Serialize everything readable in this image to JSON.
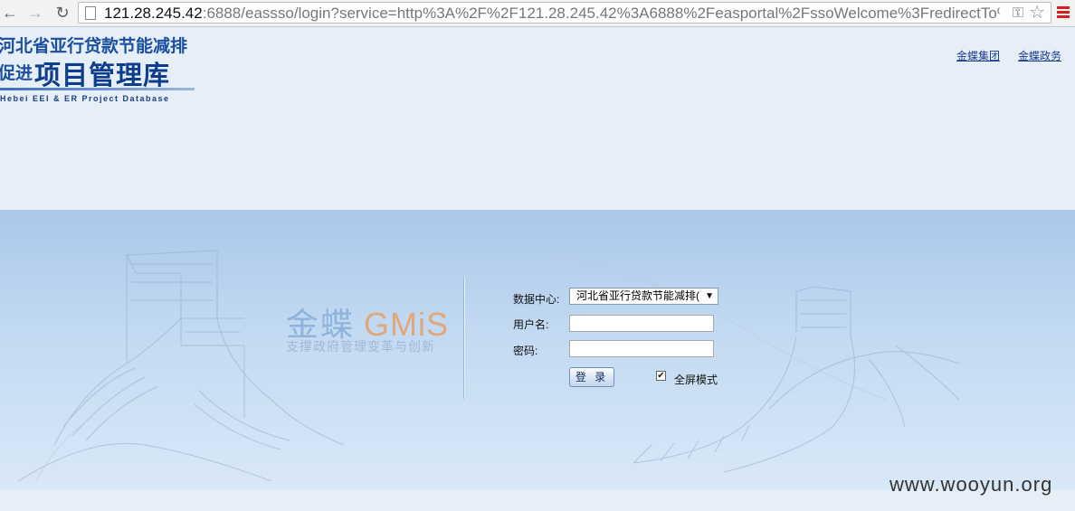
{
  "browser": {
    "url_host": "121.28.245.42",
    "url_rest": ":6888/eassso/login?service=http%3A%2F%2F121.28.245.42%3A6888%2Feasportal%2FssoWelcome%3FredirectTo%3D"
  },
  "header": {
    "logo_line1": "河北省亚行贷款节能减排",
    "logo_line2_prefix": "促进",
    "logo_line2_main": "项目管理库",
    "logo_en": "Hebei EEI & ER Project Database",
    "links": [
      "金蝶集团",
      "金蝶政务"
    ]
  },
  "brand": {
    "cn": "金蝶",
    "en": "GMiS",
    "slogan": "支撑政府管理变革与创新"
  },
  "login_form": {
    "datacenter_label": "数据中心:",
    "datacenter_value": "河北省亚行贷款节能减排(",
    "username_label": "用户名:",
    "password_label": "密码:",
    "login_button": "登 录",
    "fullscreen_label": "全屏模式",
    "fullscreen_checked": true
  },
  "watermark": "www.wooyun.org"
}
